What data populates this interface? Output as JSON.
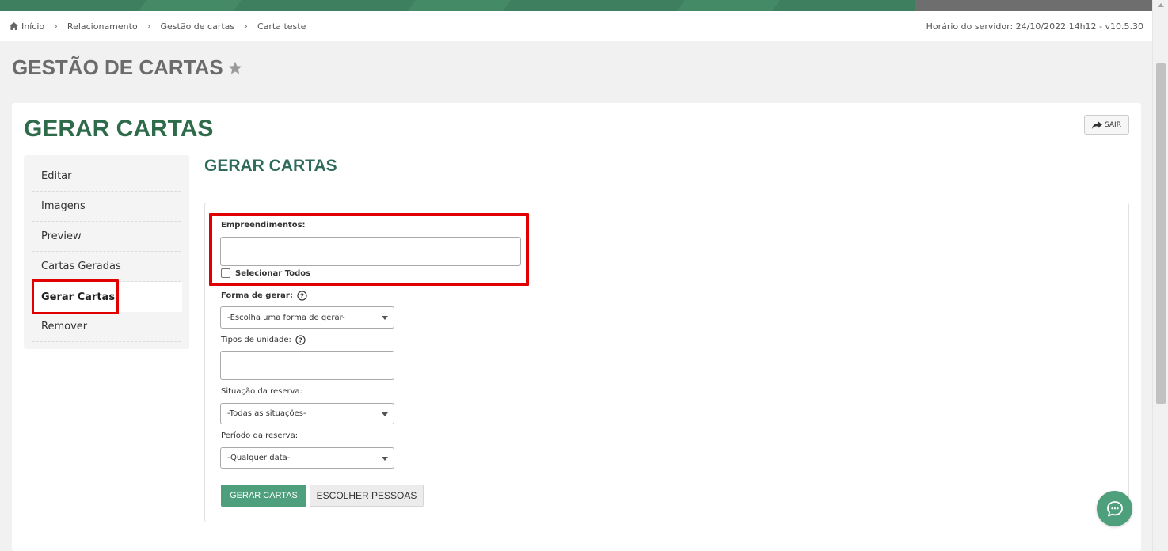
{
  "breadcrumb": {
    "items": [
      "Início",
      "Relacionamento",
      "Gestão de cartas",
      "Carta teste"
    ],
    "server_time": "Horário do servidor: 24/10/2022 14h12 - v10.5.30"
  },
  "page": {
    "title": "GESTÃO DE CARTAS"
  },
  "card": {
    "title": "GERAR CARTAS",
    "exit_label": "SAIR"
  },
  "side_menu": {
    "items": [
      "Editar",
      "Imagens",
      "Preview",
      "Cartas Geradas",
      "Gerar Cartas",
      "Remover"
    ],
    "active": "Gerar Cartas"
  },
  "form": {
    "section_title": "GERAR CARTAS",
    "empreendimentos_label": "Empreendimentos:",
    "select_all_label": "Selecionar Todos",
    "forma_label": "Forma de gerar:",
    "forma_value": "-Escolha uma forma de gerar-",
    "tipos_label": "Tipos de unidade:",
    "situacao_label": "Situação da reserva:",
    "situacao_value": "-Todas as situações-",
    "periodo_label": "Período da reserva:",
    "periodo_value": "-Qualquer data-",
    "generate_button": "GERAR CARTAS",
    "choose_people_button": "ESCOLHER PESSOAS"
  },
  "colors": {
    "brand_green": "#3d7f5e",
    "title_green": "#2e6b4a",
    "button_green": "#4e9f7b",
    "highlight_red": "#e00000"
  }
}
